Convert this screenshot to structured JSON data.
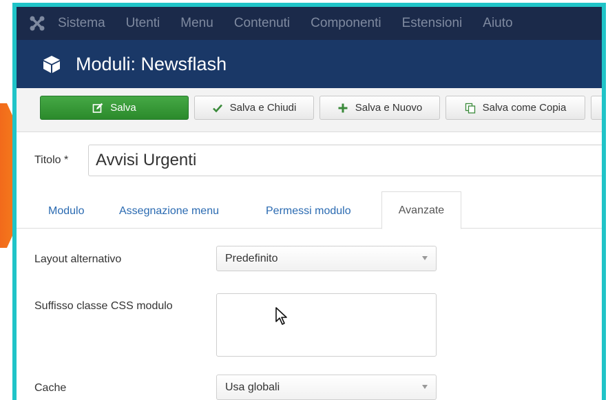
{
  "topmenu": {
    "items": [
      "Sistema",
      "Utenti",
      "Menu",
      "Contenuti",
      "Componenti",
      "Estensioni",
      "Aiuto"
    ]
  },
  "header": {
    "title": "Moduli: Newsflash"
  },
  "toolbar": {
    "save": "Salva",
    "save_close": "Salva e Chiudi",
    "save_new": "Salva e Nuovo",
    "save_copy": "Salva come Copia"
  },
  "form": {
    "title_label": "Titolo *",
    "title_value": "Avvisi Urgenti"
  },
  "tabs": {
    "items": [
      "Modulo",
      "Assegnazione menu",
      "Permessi modulo",
      "Avanzate"
    ],
    "active": "Avanzate"
  },
  "advanced": {
    "layout_label": "Layout alternativo",
    "layout_value": "Predefinito",
    "css_suffix_label": "Suffisso classe CSS modulo",
    "css_suffix_value": "",
    "cache_label": "Cache",
    "cache_value": "Usa globali"
  },
  "colors": {
    "frame": "#20c4c8",
    "topbar": "#1b2a4a",
    "titlebar": "#1a3867",
    "save_green": "#2b8a2b",
    "arrow": "#f47a20"
  }
}
